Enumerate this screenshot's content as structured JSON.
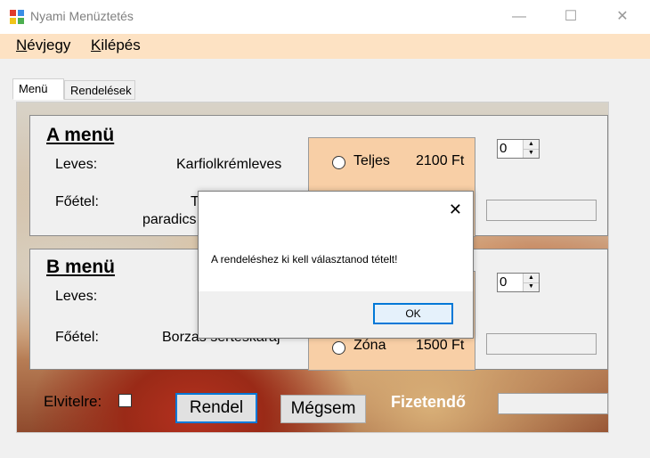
{
  "window": {
    "title": "Nyami Menüztetés",
    "minimize": "—",
    "maximize": "☐",
    "close": "✕"
  },
  "menubar": {
    "items": [
      "Névjegy",
      "Kilépés"
    ]
  },
  "tabs": {
    "items": [
      "Menü",
      "Rendelések"
    ],
    "active": 0
  },
  "menu_a": {
    "title": "A menü",
    "soup_label": "Leves:",
    "soup_value": "Karfiolkrémleves",
    "main_label": "Főétel:",
    "main_value_line1": "T",
    "main_value_line2": "paradics",
    "option_full_label": "Teljes",
    "option_full_price": "2100 Ft",
    "quantity": "0"
  },
  "menu_b": {
    "title": "B menü",
    "soup_label": "Leves:",
    "main_label": "Főétel:",
    "main_value": "Borzas sertéskaraj",
    "option_half_label": "Zóna",
    "option_half_price": "1500 Ft",
    "quantity": "0"
  },
  "footer": {
    "takeaway_label": "Elvitelre:",
    "order_button": "Rendel",
    "cancel_button": "Mégsem",
    "total_label": "Fizetendő"
  },
  "dialog": {
    "close": "✕",
    "message": "A rendeléshez ki kell választanod tételt!",
    "ok_button": "OK"
  },
  "colors": {
    "menubar_bg": "#fde2c3",
    "choice_panel_bg": "#f8cfa6",
    "accent_blue": "#0078d7"
  }
}
